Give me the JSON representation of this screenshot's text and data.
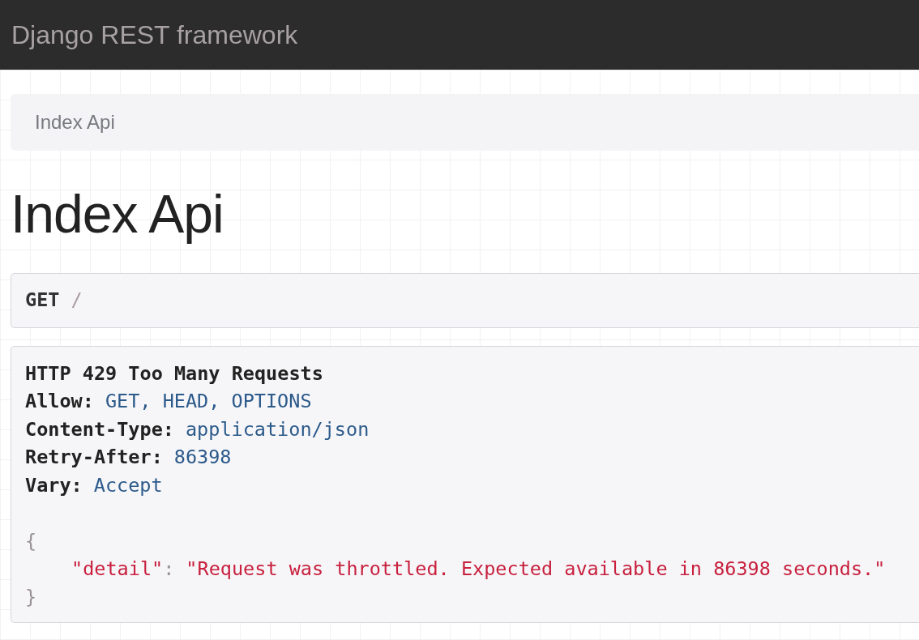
{
  "navbar": {
    "brand": "Django REST framework"
  },
  "breadcrumbs": [
    {
      "label": "Index Api",
      "active": true
    }
  ],
  "page_title": "Index Api",
  "request": {
    "method": "GET",
    "path": "/"
  },
  "response": {
    "status_line": "HTTP 429 Too Many Requests",
    "headers": [
      {
        "name": "Allow:",
        "value": "GET, HEAD, OPTIONS"
      },
      {
        "name": "Content-Type:",
        "value": "application/json"
      },
      {
        "name": "Retry-After:",
        "value": "86398"
      },
      {
        "name": "Vary:",
        "value": "Accept"
      }
    ],
    "body": {
      "open": "{",
      "entries": [
        {
          "key": "\"detail\"",
          "separator": ":",
          "value": "\"Request was throttled. Expected available in 86398 seconds.\""
        }
      ],
      "close": "}"
    }
  }
}
